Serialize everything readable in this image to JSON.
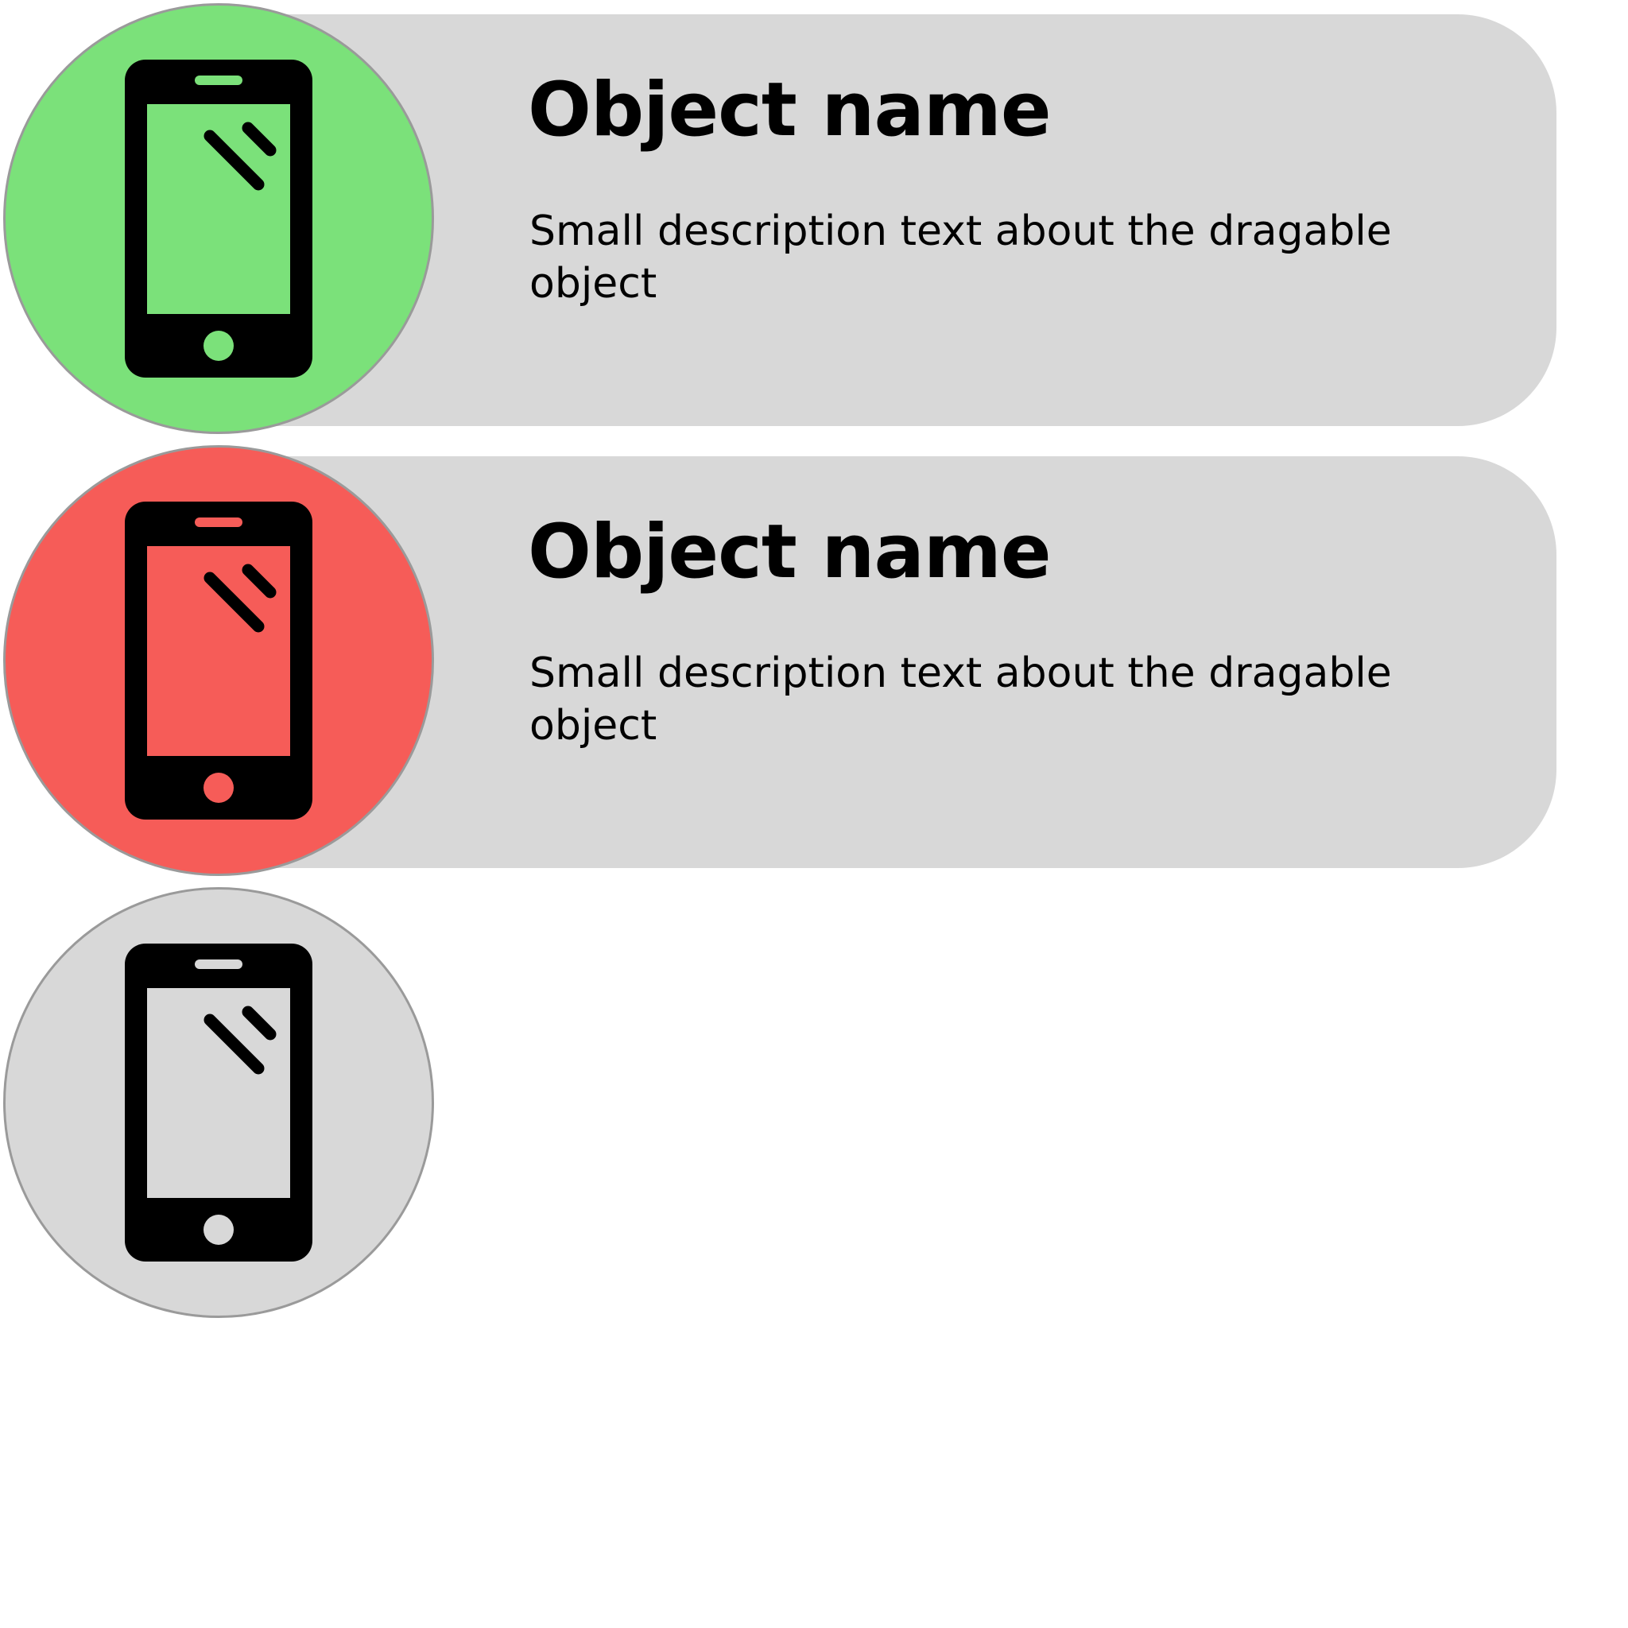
{
  "items": [
    {
      "status": "success",
      "status_color": "#7be17a",
      "icon": "smartphone-icon",
      "title": "Object name",
      "description": "Small description text about the dragable object",
      "expanded": true
    },
    {
      "status": "error",
      "status_color": "#f65c58",
      "icon": "smartphone-icon",
      "title": "Object name",
      "description": "Small description text about the dragable object",
      "expanded": true
    },
    {
      "status": "neutral",
      "status_color": "#d8d8d8",
      "icon": "smartphone-icon",
      "expanded": false
    }
  ],
  "colors": {
    "card_background": "#d8d8d8",
    "circle_border": "#9a9a9a",
    "icon": "#000000"
  }
}
